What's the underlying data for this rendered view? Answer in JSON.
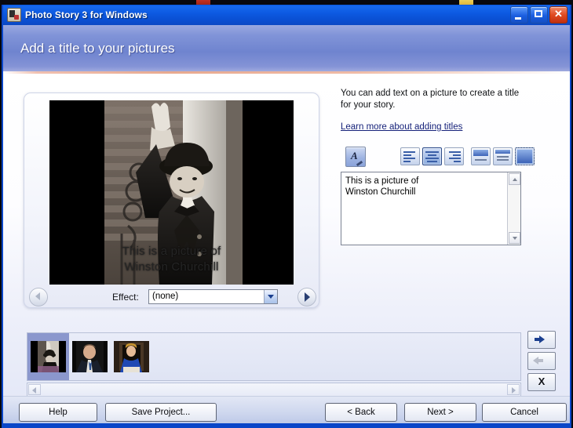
{
  "window": {
    "title": "Photo Story 3 for Windows",
    "icon": "photo-story-app-icon",
    "controls": {
      "minimize": "minimize-icon",
      "maximize": "maximize-icon",
      "close_glyph": "✕"
    }
  },
  "header": {
    "title": "Add a title to your pictures"
  },
  "preview": {
    "overlay_line1": "This is a picture of",
    "overlay_line2": "Winston Churchill",
    "effect_label": "Effect:",
    "effect_value": "(none)",
    "prev_arrow": "previous-picture-icon",
    "next_arrow": "next-picture-icon"
  },
  "right_panel": {
    "description": "You can add text on a picture to create a title for your story.",
    "link": "Learn more about adding titles",
    "font_button": "font-style-icon",
    "align_horizontal": [
      {
        "name": "align-left",
        "selected": false
      },
      {
        "name": "align-center",
        "selected": true
      },
      {
        "name": "align-right",
        "selected": false
      }
    ],
    "align_vertical": [
      {
        "name": "align-top",
        "selected": false
      },
      {
        "name": "align-middle",
        "selected": false
      },
      {
        "name": "align-bottom",
        "selected": true
      }
    ],
    "text_value_line1": "This is a picture of",
    "text_value_line2": "Winston Churchill",
    "scroll_up": "scroll-up-icon",
    "scroll_down": "scroll-down-icon"
  },
  "filmstrip": {
    "thumbnails": [
      {
        "name": "thumbnail-churchill",
        "selected": true
      },
      {
        "name": "thumbnail-man-suit",
        "selected": false
      },
      {
        "name": "thumbnail-woman-blue",
        "selected": false
      }
    ],
    "scroll_left": "scroll-left-icon",
    "scroll_right": "scroll-right-icon",
    "move_right": "move-picture-right-icon",
    "move_left": "move-picture-left-icon",
    "delete_glyph": "X"
  },
  "footer": {
    "help": "Help",
    "save_project": "Save Project...",
    "back": "< Back",
    "next": "Next >",
    "cancel": "Cancel"
  },
  "colors": {
    "titlebar_blue": "#0d5ae2",
    "header_band": "#7a8dd4",
    "accent_line": "#e8a98f",
    "selection": "#8b97cd"
  }
}
